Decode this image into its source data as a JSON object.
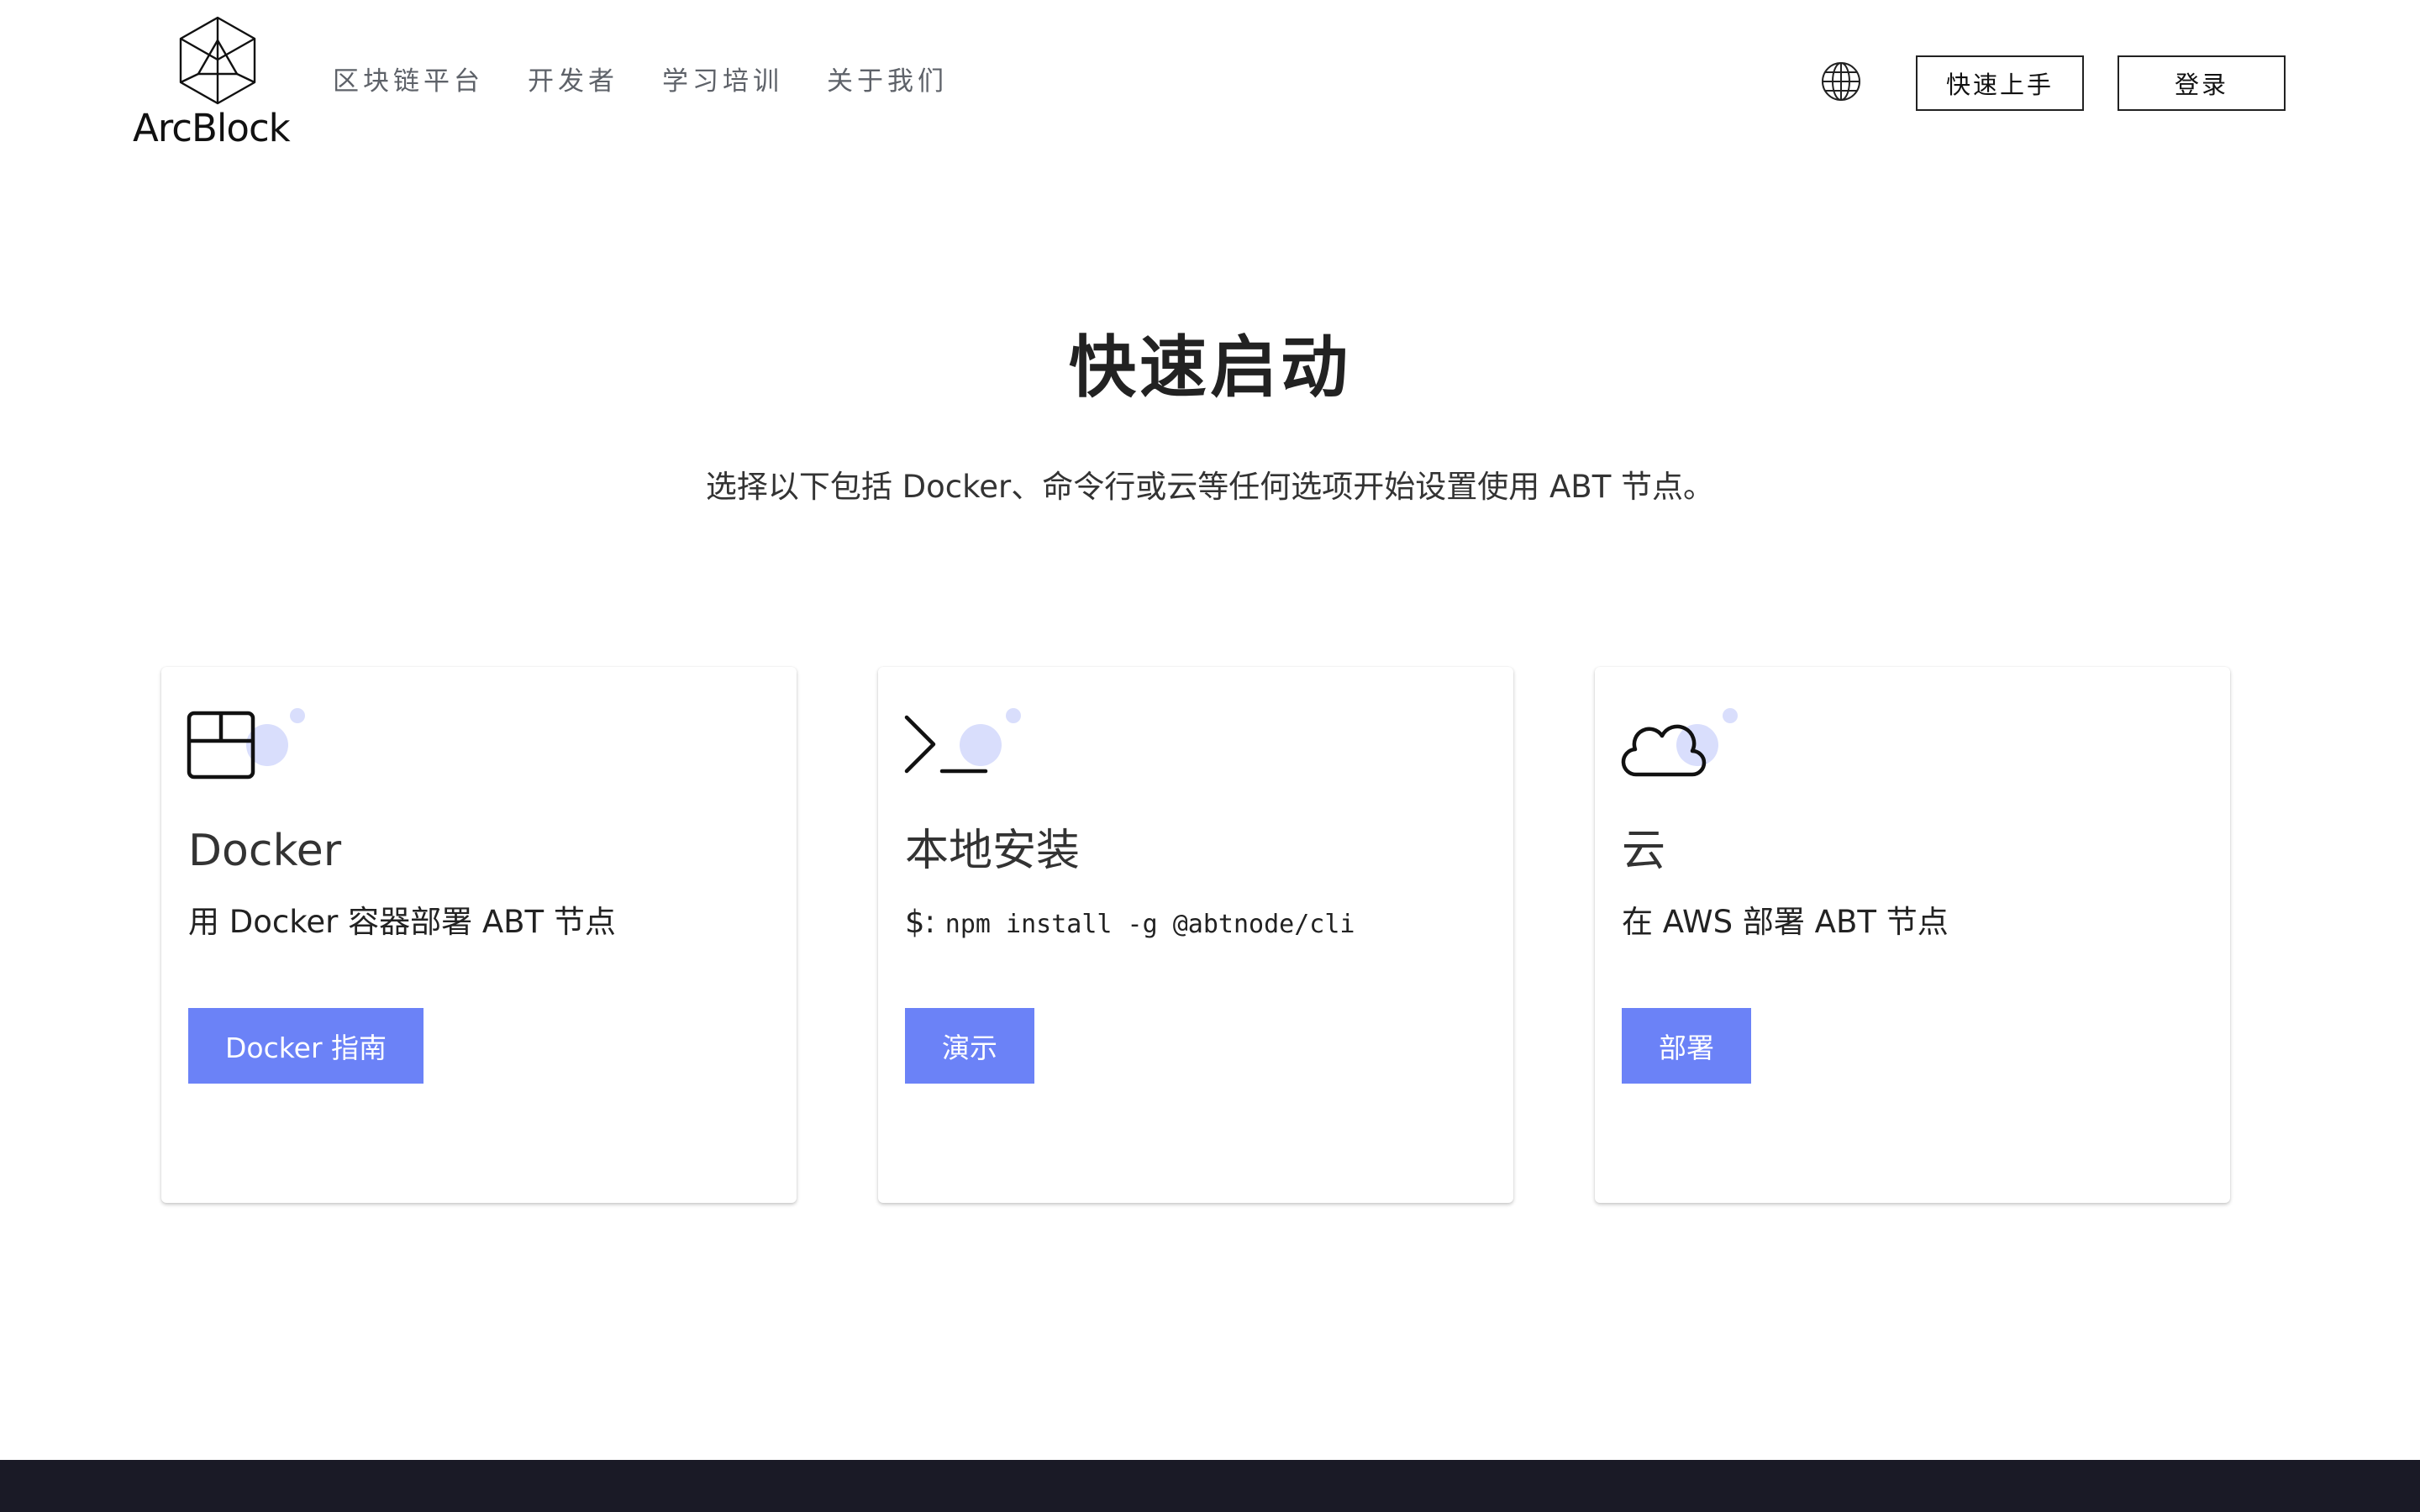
{
  "header": {
    "logo_text": "ArcBlock",
    "nav": [
      {
        "label": "区块链平台"
      },
      {
        "label": "开发者"
      },
      {
        "label": "学习培训"
      },
      {
        "label": "关于我们"
      }
    ],
    "quick_start_label": "快速上手",
    "login_label": "登录"
  },
  "hero": {
    "title": "快速启动",
    "subtitle": "选择以下包括 Docker、命令行或云等任何选项开始设置使用 ABT 节点。"
  },
  "cards": [
    {
      "icon": "box-icon",
      "title": "Docker",
      "description": "用 Docker 容器部署 ABT 节点",
      "button": "Docker 指南"
    },
    {
      "icon": "terminal-icon",
      "title": "本地安装",
      "command_prompt": "$:",
      "command": "npm install -g @abtnode/cli",
      "button": "演示"
    },
    {
      "icon": "cloud-icon",
      "title": "云",
      "description": "在 AWS 部署 ABT 节点",
      "button": "部署"
    }
  ],
  "colors": {
    "accent": "#6b82f7",
    "icon_bubble": "#d9defc",
    "footer": "#1a1a26",
    "nav_text": "#5e6269"
  }
}
